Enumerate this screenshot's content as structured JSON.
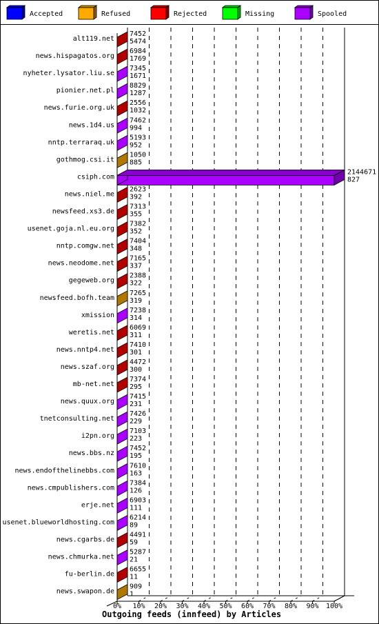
{
  "chart_data": {
    "type": "bar",
    "orientation": "horizontal",
    "title": "Outgoing feeds (innfeed) by Articles",
    "xlabel": "Outgoing feeds (innfeed) by Articles",
    "ylabel": "",
    "xlim": [
      0,
      100
    ],
    "x_unit": "%",
    "x_ticks": [
      "0%",
      "10%",
      "20%",
      "30%",
      "40%",
      "50%",
      "60%",
      "70%",
      "80%",
      "90%",
      "100%"
    ],
    "grid": true,
    "legend_position": "top",
    "legend": [
      {
        "name": "Accepted",
        "color": "#0000ff"
      },
      {
        "name": "Refused",
        "color": "#ffaa00"
      },
      {
        "name": "Rejected",
        "color": "#ff0000"
      },
      {
        "name": "Missing",
        "color": "#00ff00"
      },
      {
        "name": "Spooled",
        "color": "#aa00ff"
      }
    ],
    "categories": [
      "alt119.net",
      "news.hispagatos.org",
      "nyheter.lysator.liu.se",
      "pionier.net.pl",
      "news.furie.org.uk",
      "news.1d4.us",
      "nntp.terraraq.uk",
      "gothmog.csi.it",
      "csiph.com",
      "news.niel.me",
      "newsfeed.xs3.de",
      "usenet.goja.nl.eu.org",
      "nntp.comgw.net",
      "news.neodome.net",
      "gegeweb.org",
      "newsfeed.bofh.team",
      "xmission",
      "weretis.net",
      "news.nntp4.net",
      "news.szaf.org",
      "mb-net.net",
      "news.quux.org",
      "tnetconsulting.net",
      "i2pn.org",
      "news.bbs.nz",
      "news.endofthelinebbs.com",
      "news.cmpublishers.com",
      "erje.net",
      "usenet.blueworldhosting.com",
      "news.cgarbs.de",
      "news.chmurka.net",
      "fu-berlin.de",
      "news.swapon.de"
    ],
    "rows": [
      {
        "label": "alt119.net",
        "top": "7452",
        "bottom": "5474",
        "series": "Rejected",
        "pct": 0.3
      },
      {
        "label": "news.hispagatos.org",
        "top": "6984",
        "bottom": "1769",
        "series": "Rejected",
        "pct": 0.3
      },
      {
        "label": "nyheter.lysator.liu.se",
        "top": "7345",
        "bottom": "1671",
        "series": "Spooled",
        "pct": 0.3
      },
      {
        "label": "pionier.net.pl",
        "top": "8829",
        "bottom": "1287",
        "series": "Spooled",
        "pct": 0.3
      },
      {
        "label": "news.furie.org.uk",
        "top": "2556",
        "bottom": "1032",
        "series": "Rejected",
        "pct": 0.1
      },
      {
        "label": "news.1d4.us",
        "top": "7462",
        "bottom": "994",
        "series": "Spooled",
        "pct": 0.3
      },
      {
        "label": "nntp.terraraq.uk",
        "top": "5193",
        "bottom": "952",
        "series": "Spooled",
        "pct": 0.2
      },
      {
        "label": "gothmog.csi.it",
        "top": "1050",
        "bottom": "885",
        "series": "Refused",
        "pct": 0.0
      },
      {
        "label": "csiph.com",
        "top": "2144671",
        "bottom": "827",
        "series": "Spooled",
        "pct": 100
      },
      {
        "label": "news.niel.me",
        "top": "2623",
        "bottom": "392",
        "series": "Rejected",
        "pct": 0.1
      },
      {
        "label": "newsfeed.xs3.de",
        "top": "7313",
        "bottom": "355",
        "series": "Rejected",
        "pct": 0.3
      },
      {
        "label": "usenet.goja.nl.eu.org",
        "top": "7382",
        "bottom": "352",
        "series": "Rejected",
        "pct": 0.3
      },
      {
        "label": "nntp.comgw.net",
        "top": "7404",
        "bottom": "348",
        "series": "Rejected",
        "pct": 0.3
      },
      {
        "label": "news.neodome.net",
        "top": "7165",
        "bottom": "337",
        "series": "Rejected",
        "pct": 0.3
      },
      {
        "label": "gegeweb.org",
        "top": "2388",
        "bottom": "322",
        "series": "Rejected",
        "pct": 0.1
      },
      {
        "label": "newsfeed.bofh.team",
        "top": "7265",
        "bottom": "319",
        "series": "Refused",
        "pct": 0.3
      },
      {
        "label": "xmission",
        "top": "7238",
        "bottom": "314",
        "series": "Spooled",
        "pct": 0.3
      },
      {
        "label": "weretis.net",
        "top": "6069",
        "bottom": "311",
        "series": "Rejected",
        "pct": 0.3
      },
      {
        "label": "news.nntp4.net",
        "top": "7410",
        "bottom": "301",
        "series": "Rejected",
        "pct": 0.3
      },
      {
        "label": "news.szaf.org",
        "top": "4472",
        "bottom": "300",
        "series": "Rejected",
        "pct": 0.2
      },
      {
        "label": "mb-net.net",
        "top": "7374",
        "bottom": "295",
        "series": "Rejected",
        "pct": 0.3
      },
      {
        "label": "news.quux.org",
        "top": "7415",
        "bottom": "231",
        "series": "Spooled",
        "pct": 0.3
      },
      {
        "label": "tnetconsulting.net",
        "top": "7426",
        "bottom": "229",
        "series": "Spooled",
        "pct": 0.3
      },
      {
        "label": "i2pn.org",
        "top": "7103",
        "bottom": "223",
        "series": "Spooled",
        "pct": 0.3
      },
      {
        "label": "news.bbs.nz",
        "top": "7452",
        "bottom": "195",
        "series": "Spooled",
        "pct": 0.3
      },
      {
        "label": "news.endofthelinebbs.com",
        "top": "7610",
        "bottom": "163",
        "series": "Spooled",
        "pct": 0.4
      },
      {
        "label": "news.cmpublishers.com",
        "top": "7384",
        "bottom": "126",
        "series": "Spooled",
        "pct": 0.3
      },
      {
        "label": "erje.net",
        "top": "6903",
        "bottom": "111",
        "series": "Spooled",
        "pct": 0.3
      },
      {
        "label": "usenet.blueworldhosting.com",
        "top": "6214",
        "bottom": "89",
        "series": "Spooled",
        "pct": 0.3
      },
      {
        "label": "news.cgarbs.de",
        "top": "4491",
        "bottom": "59",
        "series": "Rejected",
        "pct": 0.2
      },
      {
        "label": "news.chmurka.net",
        "top": "5287",
        "bottom": "21",
        "series": "Spooled",
        "pct": 0.2
      },
      {
        "label": "fu-berlin.de",
        "top": "6655",
        "bottom": "11",
        "series": "Rejected",
        "pct": 0.3
      },
      {
        "label": "news.swapon.de",
        "top": "909",
        "bottom": "1",
        "series": "Refused",
        "pct": 0.0
      }
    ]
  },
  "series_colors": {
    "Accepted": {
      "front": "#0000ff",
      "side": "#0000aa",
      "top": "#0000cc"
    },
    "Refused": {
      "front": "#b07800",
      "side": "#8a5e00",
      "top": "#c88a00"
    },
    "Rejected": {
      "front": "#b00000",
      "side": "#800000",
      "top": "#c00000"
    },
    "Missing": {
      "front": "#00ff00",
      "side": "#00aa00",
      "top": "#00cc00"
    },
    "Spooled": {
      "front": "#aa00ff",
      "side": "#7000aa",
      "top": "#8800cc"
    }
  },
  "highlight_bar_front": "#aa00ff"
}
